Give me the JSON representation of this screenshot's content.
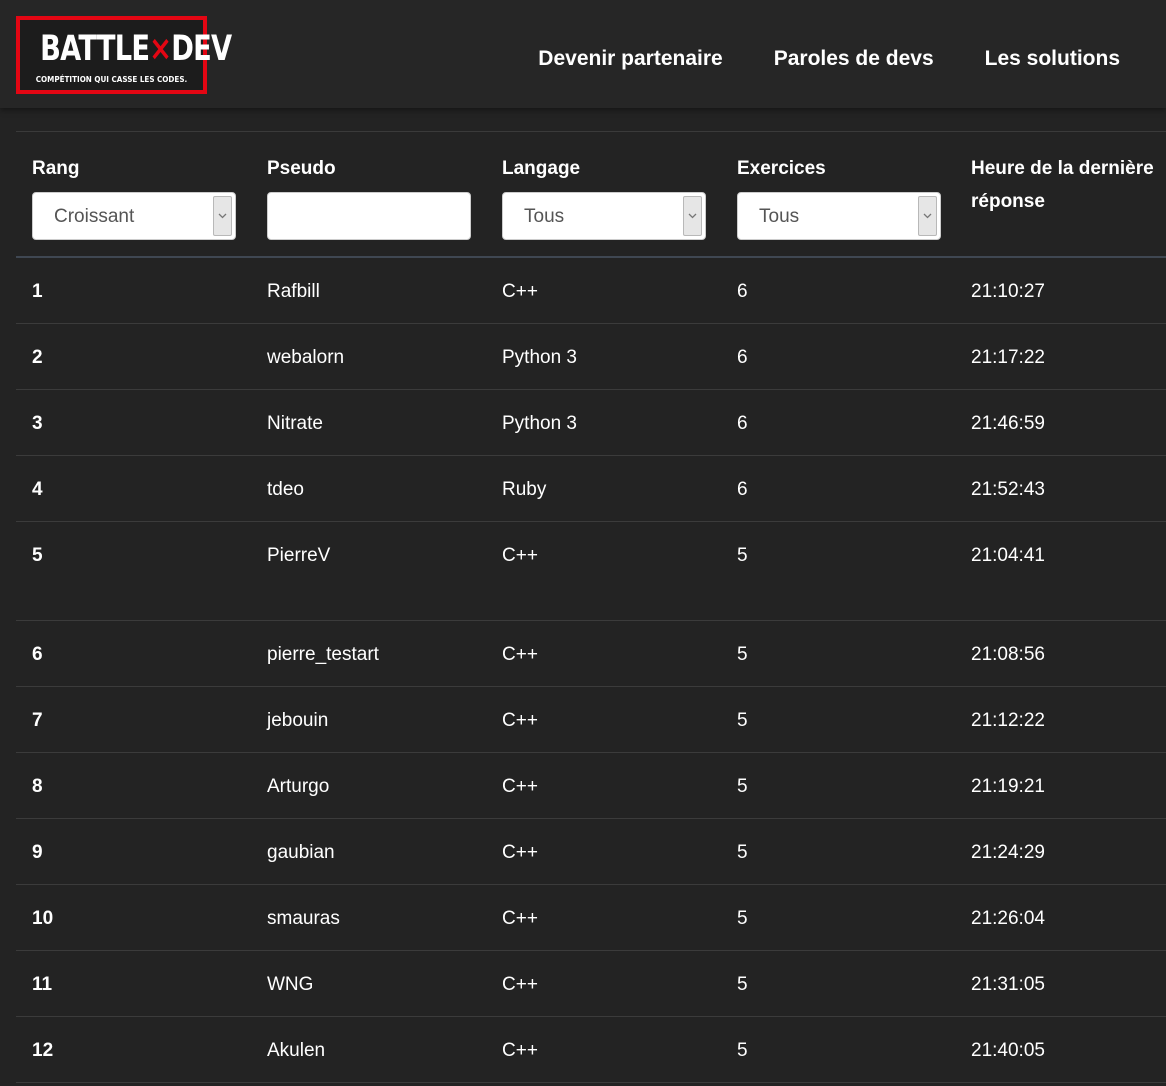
{
  "logo": {
    "line1_left": "BATTLE",
    "line1_x": "×",
    "line1_right": "DEV",
    "tagline": "COMPÉTITION QUI CASSE LES CODES."
  },
  "nav": {
    "items": [
      "Devenir partenaire",
      "Paroles de devs",
      "Les solutions"
    ]
  },
  "table": {
    "headers": {
      "rank": "Rang",
      "pseudo": "Pseudo",
      "language": "Langage",
      "exercises": "Exercices",
      "last_answer": "Heure de la dernière réponse"
    },
    "filters": {
      "rank_sort": "Croissant",
      "pseudo": "",
      "language": "Tous",
      "exercises": "Tous"
    },
    "rows": [
      {
        "rank": "1",
        "pseudo": "Rafbill",
        "language": "C++",
        "exercises": "6",
        "time": "21:10:27"
      },
      {
        "rank": "2",
        "pseudo": "webalorn",
        "language": "Python 3",
        "exercises": "6",
        "time": "21:17:22"
      },
      {
        "rank": "3",
        "pseudo": "Nitrate",
        "language": "Python 3",
        "exercises": "6",
        "time": "21:46:59"
      },
      {
        "rank": "4",
        "pseudo": "tdeo",
        "language": "Ruby",
        "exercises": "6",
        "time": "21:52:43"
      },
      {
        "rank": "5",
        "pseudo": "PierreV",
        "language": "C++",
        "exercises": "5",
        "time": "21:04:41"
      },
      {
        "rank": "6",
        "pseudo": "pierre_testart",
        "language": "C++",
        "exercises": "5",
        "time": "21:08:56"
      },
      {
        "rank": "7",
        "pseudo": "jebouin",
        "language": "C++",
        "exercises": "5",
        "time": "21:12:22"
      },
      {
        "rank": "8",
        "pseudo": "Arturgo",
        "language": "C++",
        "exercises": "5",
        "time": "21:19:21"
      },
      {
        "rank": "9",
        "pseudo": "gaubian",
        "language": "C++",
        "exercises": "5",
        "time": "21:24:29"
      },
      {
        "rank": "10",
        "pseudo": "smauras",
        "language": "C++",
        "exercises": "5",
        "time": "21:26:04"
      },
      {
        "rank": "11",
        "pseudo": "WNG",
        "language": "C++",
        "exercises": "5",
        "time": "21:31:05"
      },
      {
        "rank": "12",
        "pseudo": "Akulen",
        "language": "C++",
        "exercises": "5",
        "time": "21:40:05"
      }
    ]
  },
  "colors": {
    "background": "#232323",
    "header": "#262626",
    "brand_red": "#e30613",
    "text": "#ffffff"
  }
}
